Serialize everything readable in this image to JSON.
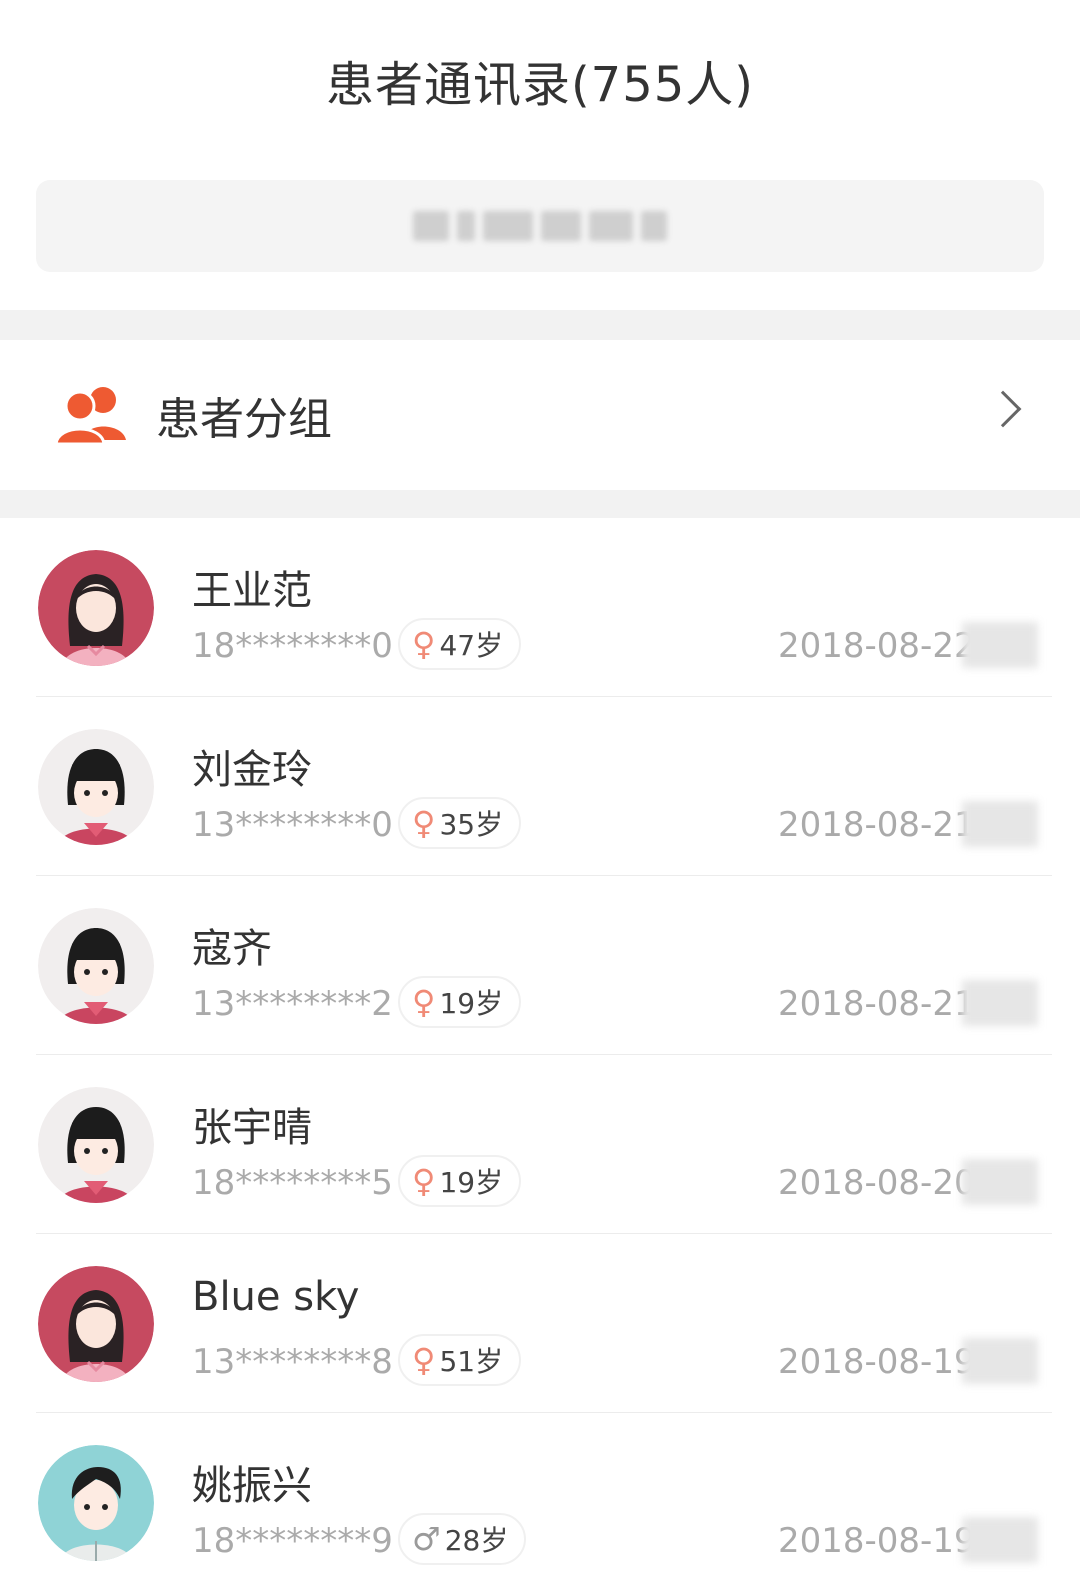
{
  "header": {
    "title": "患者通讯录(755人)"
  },
  "search": {
    "placeholder": ""
  },
  "group": {
    "label": "患者分组",
    "icon": "group-icon"
  },
  "colors": {
    "accent": "#ee5a32",
    "female_symbol": "#f08a76",
    "male_symbol": "#9a9a9a"
  },
  "patients": [
    {
      "name": "王业范",
      "phone": "18********0",
      "gender_symbol": "♀",
      "age": "47岁",
      "date": "2018-08-22",
      "avatar": "woman-long-hair-icon"
    },
    {
      "name": "刘金玲",
      "phone": "13********0",
      "gender_symbol": "♀",
      "age": "35岁",
      "date": "2018-08-21",
      "avatar": "girl-short-hair-icon"
    },
    {
      "name": "寇齐",
      "phone": "13********2",
      "gender_symbol": "♀",
      "age": "19岁",
      "date": "2018-08-21",
      "avatar": "girl-short-hair-icon"
    },
    {
      "name": "张宇晴",
      "phone": "18********5",
      "gender_symbol": "♀",
      "age": "19岁",
      "date": "2018-08-20",
      "avatar": "girl-short-hair-icon"
    },
    {
      "name": "Blue sky",
      "phone": "13********8",
      "gender_symbol": "♀",
      "age": "51岁",
      "date": "2018-08-19",
      "avatar": "woman-long-hair-icon"
    },
    {
      "name": "姚振兴",
      "phone": "18********9",
      "gender_symbol": "♂",
      "age": "28岁",
      "date": "2018-08-19",
      "avatar": "man-icon"
    }
  ]
}
